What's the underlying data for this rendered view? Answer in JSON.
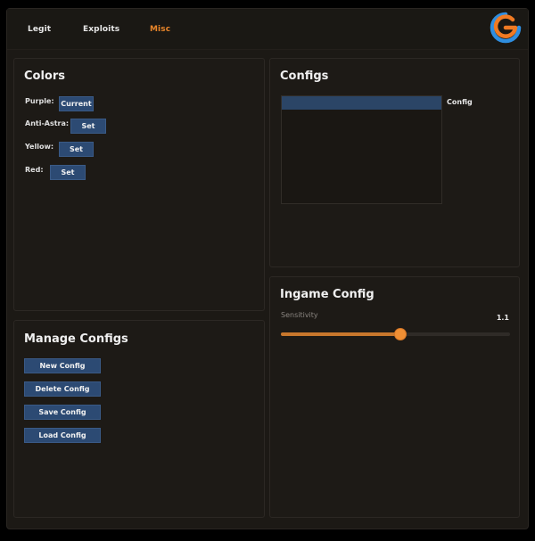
{
  "tabs": [
    {
      "label": "Legit",
      "active": false
    },
    {
      "label": "Exploits",
      "active": false
    },
    {
      "label": "Misc",
      "active": true
    }
  ],
  "colors_panel": {
    "title": "Colors",
    "rows": [
      {
        "label": "Purple:",
        "button": "Current"
      },
      {
        "label": "Anti-Astra:",
        "button": "Set"
      },
      {
        "label": "Yellow:",
        "button": "Set"
      },
      {
        "label": "Red:",
        "button": "Set"
      }
    ]
  },
  "manage_panel": {
    "title": "Manage Configs",
    "buttons": [
      "New Config",
      "Delete Config",
      "Save Config",
      "Load Config"
    ]
  },
  "configs_panel": {
    "title": "Configs",
    "side_label": "Config"
  },
  "ingame_panel": {
    "title": "Ingame Config",
    "slider_label": "Sensitivity",
    "slider_value": "1.1",
    "slider_fraction": 0.52
  },
  "theme": {
    "accent": "#e8852a",
    "button_bg": "#2c4a73",
    "background": "#1c1915",
    "logo_blue": "#2f8ee0",
    "logo_orange": "#f07a23"
  },
  "icons": {
    "logo": "g-logo-icon"
  }
}
